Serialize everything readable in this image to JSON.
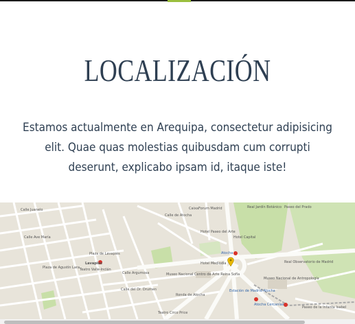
{
  "section": {
    "title": "LOCALIZACIÓN",
    "text": "Estamos actualmente en Arequipa, consectetur adipisicing elit. Quae quas molestias quibusdam cum corrupti deserunt, explicabo ipsam id, itaque iste!"
  },
  "map": {
    "labels": {
      "calle_juanelo": "Calle Juanelo",
      "calle_ave_maria": "Calle Ave María",
      "calle_atocha": "Calle de Atocha",
      "plaza_lavapies": "Plaza de Lavapiés",
      "lavapies": "Lavapiés",
      "teatro_valle_inclan": "Teatro Valle-Inclán",
      "plaza_agustin_lara": "Plaza de Agustín Lara",
      "calle_argumosa": "Calle Argumosa",
      "museo_reina_sofia": "Museo Nacional Centro de Arte Reina Sofía",
      "caixaforum": "CaixaForum Madrid",
      "real_jardin_botanico": "Real Jardín Botánico",
      "paseo_del_arte": "Hotel Paseo del Arte",
      "atocha": "Atocha",
      "hotel_mediodia": "Hotel Mediodía",
      "estacion_atocha": "Estación de Madrid Atocha",
      "atocha_cercanias": "Atocha Cercanías",
      "observatorio": "Real Observatorio de Madrid",
      "museo_antropologia": "Museo Nacional de Antropología",
      "ronda_atocha": "Ronda de Atocha",
      "paseo_infanta_isabel": "Paseo de la Infanta Isabel",
      "calle_doctor_drumen": "Calle del Dr. Drumen",
      "teatro_circo_price": "Teatro Circo Price",
      "hotel_capital": "Hotel Capital",
      "paseo_del_prado": "Paseo del Prado"
    },
    "colors": {
      "land": "#e8e4da",
      "road": "#ffffff",
      "park": "#c8dfa8",
      "pin": "#e8b800",
      "transit": "#d9322a"
    }
  },
  "icons": {
    "map_pin": "map-pin-icon",
    "transit": "transit-station-icon"
  }
}
